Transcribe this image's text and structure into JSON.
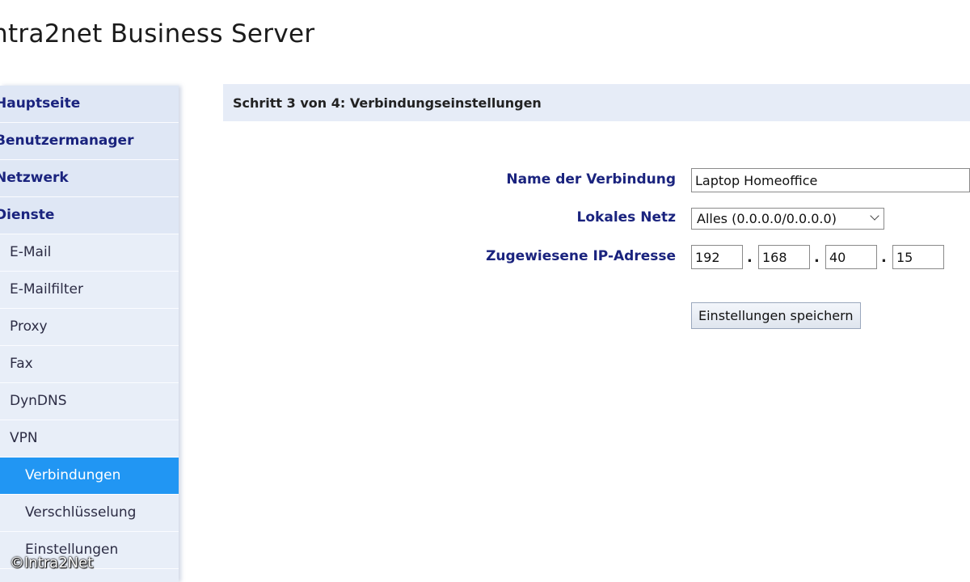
{
  "app": {
    "logo_text": "ntra2net Business Server"
  },
  "sidebar": {
    "items": [
      {
        "label": "Hauptseite"
      },
      {
        "label": "Benutzermanager"
      },
      {
        "label": "Netzwerk"
      },
      {
        "label": "Dienste"
      },
      {
        "label": "E-Mail"
      },
      {
        "label": "E-Mailfilter"
      },
      {
        "label": "Proxy"
      },
      {
        "label": "Fax"
      },
      {
        "label": "DynDNS"
      },
      {
        "label": "VPN"
      },
      {
        "label": "Verbindungen"
      },
      {
        "label": "Verschlüsselung"
      },
      {
        "label": "Einstellungen"
      }
    ]
  },
  "panel": {
    "title": "Schritt 3 von 4: Verbindungseinstellungen",
    "form": {
      "name_label": "Name der Verbindung",
      "name_value": "Laptop Homeoffice",
      "network_label": "Lokales Netz",
      "network_selected": "Alles (0.0.0.0/0.0.0.0)",
      "ip_label": "Zugewiesene IP-Adresse",
      "ip_octets": [
        "192",
        "168",
        "40",
        "15"
      ],
      "ip_separator": ".",
      "save_label": "Einstellungen speichern"
    }
  },
  "watermark": "©Intra2Net"
}
